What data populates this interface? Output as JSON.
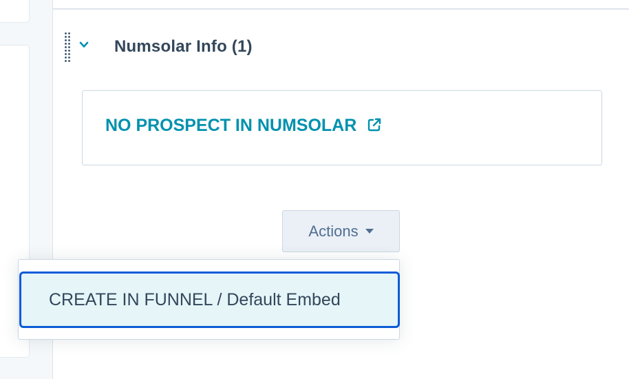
{
  "section": {
    "title": "Numsolar Info (1)"
  },
  "card": {
    "link_text": "NO PROSPECT IN NUMSOLAR"
  },
  "actions": {
    "label": "Actions"
  },
  "dropdown": {
    "items": [
      {
        "label": "CREATE IN FUNNEL / Default Embed"
      }
    ]
  },
  "icons": {
    "drag": "drag-handle-icon",
    "chevron": "chevron-down-icon",
    "external": "external-link-icon",
    "caret": "caret-down-icon"
  },
  "colors": {
    "accent": "#0091ae",
    "heading": "#33475b",
    "focus_border": "#0b5bd7",
    "button_bg": "#eaf0f6",
    "menu_highlight": "#e5f5f8"
  }
}
